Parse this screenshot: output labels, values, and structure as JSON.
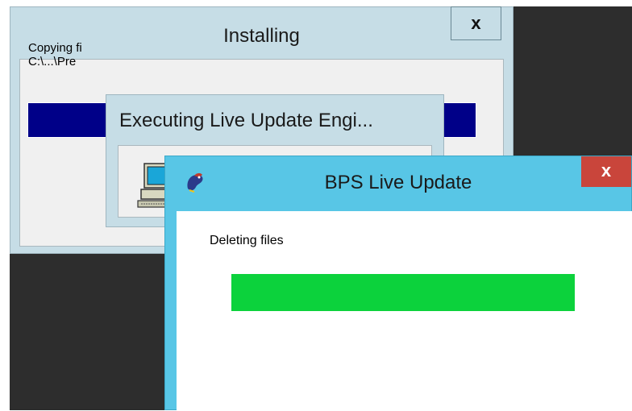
{
  "windows": {
    "installing": {
      "title": "Installing",
      "close_label": "x",
      "status_text": "Copying fi",
      "path_text": "C:\\...\\Pre",
      "progress_fraction": 1.0,
      "progress_color": "#000088"
    },
    "executing": {
      "title": "Executing Live Update Engi...",
      "icon": "computer-icon"
    },
    "bps_live_update": {
      "title": "BPS Live Update",
      "app_icon": "bps-parrot-icon",
      "close_label": "x",
      "status_text": "Deleting files",
      "progress_fraction": 1.0,
      "progress_color": "#0cd23c",
      "titlebar_color": "#58c6e6",
      "close_color": "#c9453b"
    }
  }
}
